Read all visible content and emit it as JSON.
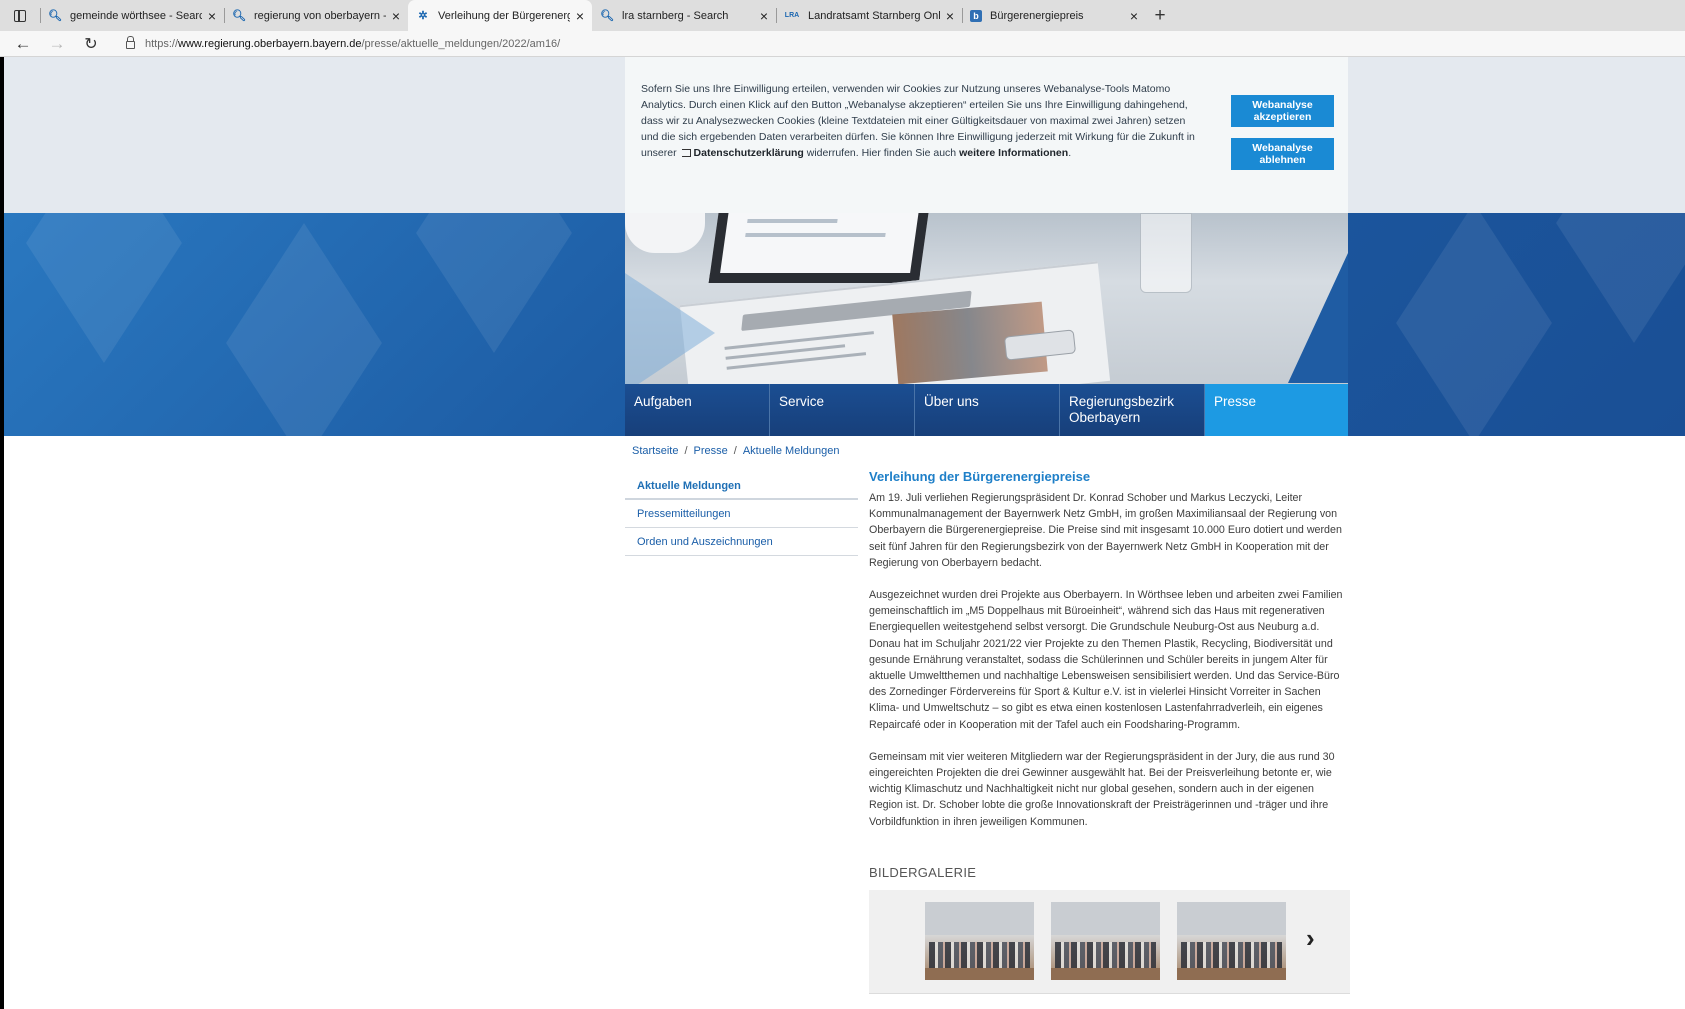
{
  "browser": {
    "tabs": [
      {
        "title": "gemeinde wörthsee - Search",
        "favicon": "search-icon"
      },
      {
        "title": "regierung von oberbayern - Sear",
        "favicon": "search-icon"
      },
      {
        "title": "Verleihung der Bürgerenergiepre",
        "favicon": "bavaria-logo-icon",
        "active": true
      },
      {
        "title": "lra starnberg - Search",
        "favicon": "search-icon"
      },
      {
        "title": "Landratsamt Starnberg Online",
        "favicon": "lra-logo-icon"
      },
      {
        "title": "Bürgerenergiepreis",
        "favicon": "b-logo-icon"
      }
    ],
    "url_prefix": "https://",
    "url_host": "www.regierung.oberbayern.bayern.de",
    "url_path": "/presse/aktuelle_meldungen/2022/am16/"
  },
  "cookie_banner": {
    "text_1": "Sofern Sie uns Ihre Einwilligung erteilen, verwenden wir Cookies zur Nutzung unseres Webanalyse-Tools Matomo Analytics. Durch einen Klick auf den Button „Webanalyse akzeptieren“ erteilen Sie uns Ihre Einwilligung dahingehend, dass wir zu Analysezwecken Cookies (kleine Textdateien mit einer Gültigkeitsdauer von maximal zwei Jahren) setzen und die sich ergebenden Daten verarbeiten dürfen. Sie können Ihre Einwilligung jederzeit mit Wirkung für die Zukunft in unserer",
    "privacy_link": "Datenschutzerklärung",
    "text_2": "widerrufen. Hier finden Sie auch",
    "more_link": "weitere Informationen",
    "text_3": ".",
    "accept_label": "Webanalyse akzeptieren",
    "decline_label": "Webanalyse ablehnen"
  },
  "main_nav": [
    {
      "label": "Aufgaben"
    },
    {
      "label": "Service"
    },
    {
      "label": "Über uns"
    },
    {
      "label": "Regierungsbezirk Oberbayern"
    },
    {
      "label": "Presse",
      "active": true
    }
  ],
  "breadcrumb": [
    "Startseite",
    "Presse",
    "Aktuelle Meldungen"
  ],
  "sidebar": [
    {
      "label": "Aktuelle Meldungen",
      "active": true
    },
    {
      "label": "Pressemitteilungen"
    },
    {
      "label": "Orden und Auszeichnungen"
    }
  ],
  "article": {
    "title": "Verleihung der Bürgerenergiepreise",
    "paragraphs": [
      "Am 19. Juli verliehen Regierungspräsident Dr. Konrad Schober und Markus Leczycki, Leiter Kommunalmanagement der Bayernwerk Netz GmbH, im großen Maximiliansaal der Regierung von Oberbayern die Bürgerenergiepreise. Die Preise sind mit insgesamt 10.000 Euro dotiert und werden seit fünf Jahren für den Regierungsbezirk von der Bayernwerk Netz GmbH in Kooperation mit der Regierung von Oberbayern bedacht.",
      "Ausgezeichnet wurden drei Projekte aus Oberbayern. In Wörthsee leben und arbeiten zwei Familien gemeinschaftlich im „M5 Doppelhaus mit Büroeinheit“, während sich das Haus mit regenerativen Energiequellen weitestgehend selbst versorgt. Die Grundschule Neuburg-Ost aus Neuburg a.d. Donau hat im Schuljahr 2021/22 vier Projekte zu den Themen Plastik, Recycling, Biodiversität und gesunde Ernährung veranstaltet, sodass die Schülerinnen und Schüler bereits in jungem Alter für aktuelle Umweltthemen und nachhaltige Lebensweisen sensibilisiert werden. Und das Service-Büro des Zornedinger Fördervereins für Sport & Kultur e.V. ist in vielerlei Hinsicht Vorreiter in Sachen Klima- und Umweltschutz – so gibt es etwa einen kostenlosen Lastenfahrradverleih, ein eigenes Repaircafé oder in Kooperation mit der Tafel auch ein Foodsharing-Programm.",
      "Gemeinsam mit vier weiteren Mitgliedern war der Regierungspräsident in der Jury, die aus rund 30 eingereichten Projekten die drei Gewinner ausgewählt hat. Bei der Preisverleihung betonte er, wie wichtig Klimaschutz und Nachhaltigkeit nicht nur global gesehen, sondern auch in der eigenen Region ist. Dr. Schober lobte die große Innovationskraft der Preisträgerinnen und -träger und ihre Vorbildfunktion in ihren jeweiligen Kommunen."
    ],
    "gallery_title": "BILDERGALERIE"
  }
}
